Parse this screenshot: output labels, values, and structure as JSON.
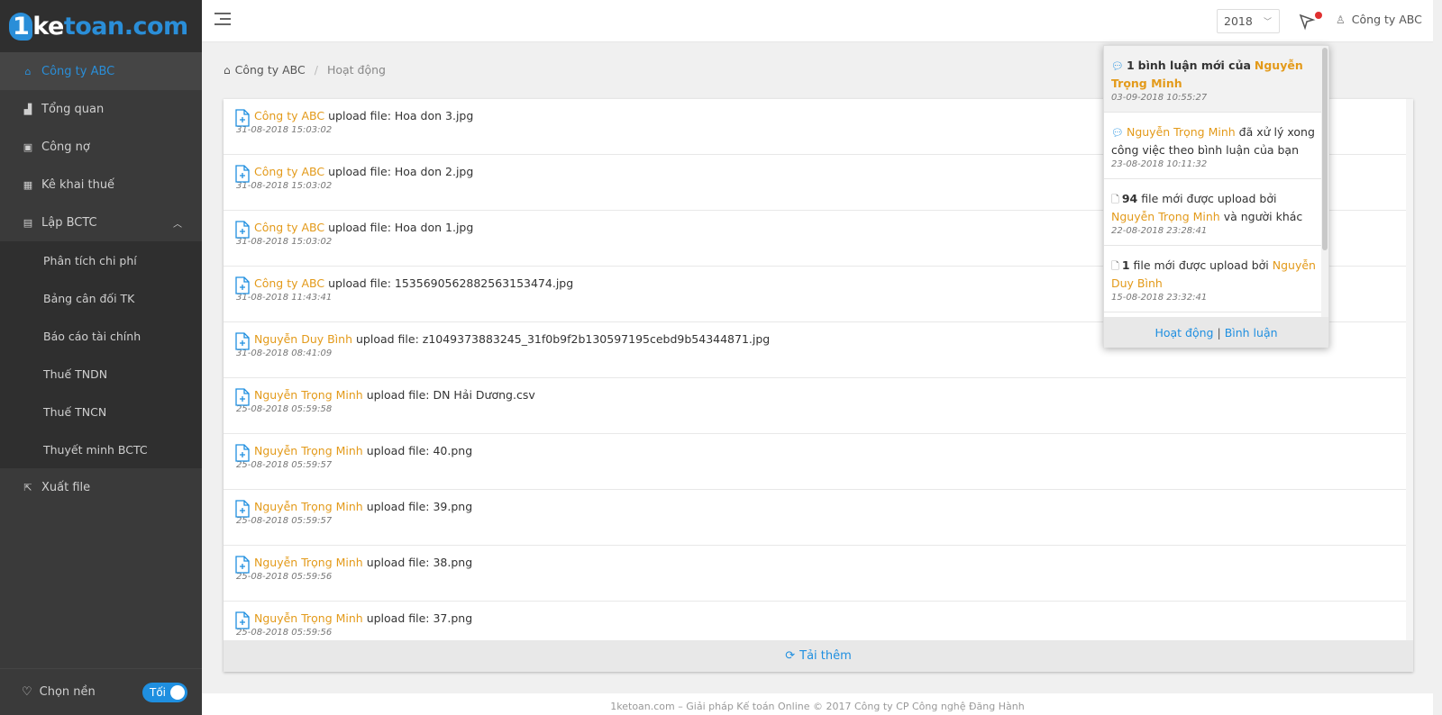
{
  "brand": {
    "logo_1": "1",
    "logo_k": "ke",
    "logo_rest": "toan.com"
  },
  "sidebar": {
    "items": [
      {
        "label": "Công ty ABC",
        "icon": "home-icon"
      },
      {
        "label": "Tổng quan",
        "icon": "chart-icon"
      },
      {
        "label": "Công nợ",
        "icon": "ledger-icon"
      },
      {
        "label": "Kê khai thuế",
        "icon": "grid-icon"
      },
      {
        "label": "Lập BCTC",
        "icon": "report-icon"
      }
    ],
    "sub_items": [
      {
        "label": "Phân tích chi phí"
      },
      {
        "label": "Bảng cân đối TK"
      },
      {
        "label": "Báo cáo tài chính"
      },
      {
        "label": "Thuế TNDN"
      },
      {
        "label": "Thuế TNCN"
      },
      {
        "label": "Thuyết minh BCTC"
      }
    ],
    "export": {
      "label": "Xuất file",
      "icon": "export-icon"
    },
    "theme": {
      "label": "Chọn nền",
      "toggle_label": "Tối"
    }
  },
  "header": {
    "year": "2018",
    "user": "Công ty ABC"
  },
  "breadcrumb": {
    "home": "Công ty ABC",
    "sep": "/",
    "current": "Hoạt động"
  },
  "activities": [
    {
      "actor": "Công ty ABC",
      "action": "upload file: Hoa don 3.jpg",
      "time": "31-08-2018 15:03:02"
    },
    {
      "actor": "Công ty ABC",
      "action": "upload file: Hoa don 2.jpg",
      "time": "31-08-2018 15:03:02"
    },
    {
      "actor": "Công ty ABC",
      "action": "upload file: Hoa don 1.jpg",
      "time": "31-08-2018 15:03:02"
    },
    {
      "actor": "Công ty ABC",
      "action": "upload file: 1535690562882563153474.jpg",
      "time": "31-08-2018 11:43:41"
    },
    {
      "actor": "Nguyễn Duy Bình",
      "action": "upload file: z1049373883245_31f0b9f2b130597195cebd9b54344871.jpg",
      "time": "31-08-2018 08:41:09"
    },
    {
      "actor": "Nguyễn Trọng Minh",
      "action": "upload file: DN Hải Dương.csv",
      "time": "25-08-2018 05:59:58"
    },
    {
      "actor": "Nguyễn Trọng Minh",
      "action": "upload file: 40.png",
      "time": "25-08-2018 05:59:57"
    },
    {
      "actor": "Nguyễn Trọng Minh",
      "action": "upload file: 39.png",
      "time": "25-08-2018 05:59:57"
    },
    {
      "actor": "Nguyễn Trọng Minh",
      "action": "upload file: 38.png",
      "time": "25-08-2018 05:59:56"
    },
    {
      "actor": "Nguyễn Trọng Minh",
      "action": "upload file: 37.png",
      "time": "25-08-2018 05:59:56"
    }
  ],
  "load_more": "Tải thêm",
  "notifications": {
    "items": [
      {
        "count": "1",
        "text_before": "bình luận mới của",
        "name": "Nguyễn Trọng Minh",
        "text_after": "",
        "time": "03-09-2018 10:55:27"
      },
      {
        "count": "",
        "text_before": "",
        "name": "Nguyễn Trọng Minh",
        "text_after": "đã xử lý xong công việc theo bình luận của bạn",
        "time": "23-08-2018 10:11:32"
      },
      {
        "count": "94",
        "text_before": "file mới được upload bởi",
        "name": "Nguyễn Trọng Minh",
        "text_after": "và người khác",
        "time": "22-08-2018 23:28:41"
      },
      {
        "count": "1",
        "text_before": "file mới được upload bởi",
        "name": "Nguyễn Duy Bình",
        "text_after": "",
        "time": "15-08-2018 23:32:41"
      }
    ],
    "footer_activity": "Hoạt động",
    "footer_sep": "|",
    "footer_comments": "Bình luận"
  },
  "footer_text": "1ketoan.com – Giải pháp Kế toán Online © 2017 Công ty CP Công nghệ Đăng Hành",
  "colors": {
    "accent": "#1f8fe0",
    "actor": "#e39a1a",
    "sidebar": "#3a3a3a",
    "badge": "#e03030"
  }
}
